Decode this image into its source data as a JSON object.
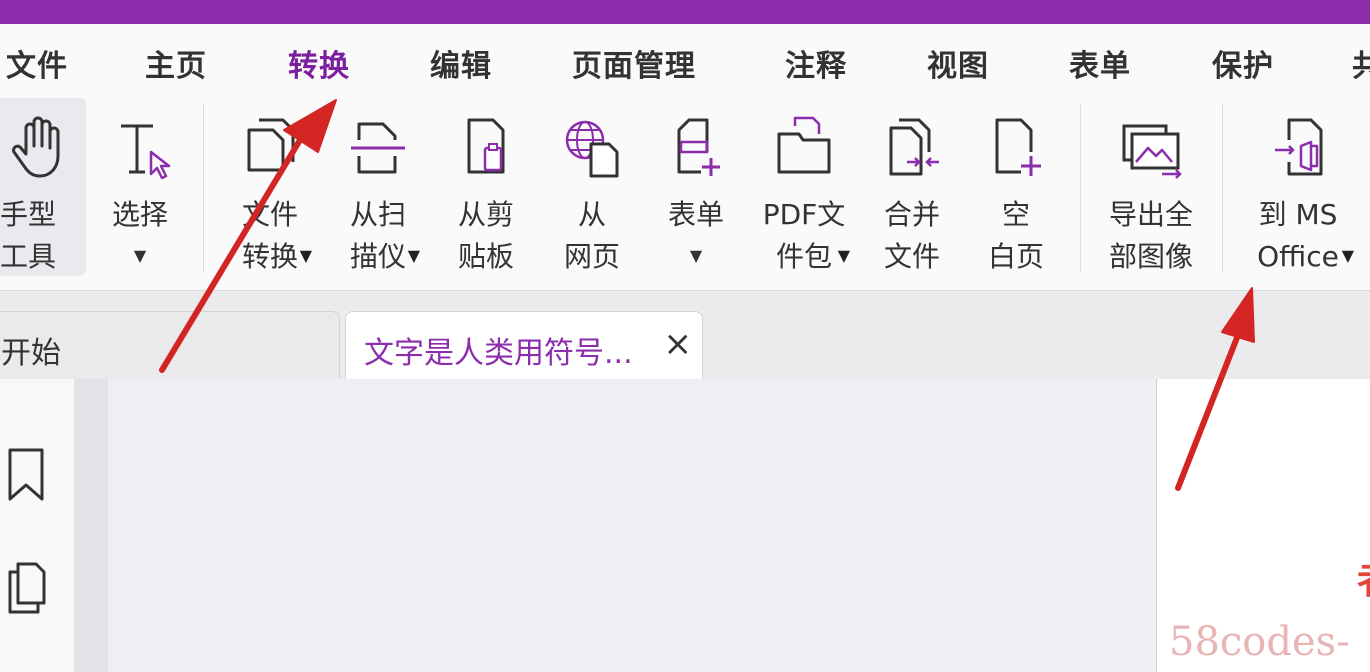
{
  "menu": {
    "items": [
      "文件",
      "主页",
      "转换",
      "编辑",
      "页面管理",
      "注释",
      "视图",
      "表单",
      "保护",
      "共"
    ],
    "active_index": 2
  },
  "ribbon": {
    "hand_tool": "手型\n工具",
    "select": "选择",
    "file_convert": "文件\n转换",
    "from_scanner": "从扫\n描仪",
    "from_clipboard": "从剪\n贴板",
    "from_webpage": "从\n网页",
    "form": "表单",
    "pdf_portfolio": "PDF文\n件包",
    "merge_files": "合并\n文件",
    "blank_page": "空\n白页",
    "export_images": "导出全\n部图像",
    "to_ms_office": "到 MS\nOffice"
  },
  "tabs": {
    "start": "开始",
    "document": "文字是人类用符号...",
    "close_glyph": "×"
  },
  "document": {
    "visible_char": "者"
  },
  "watermark": "58codes-",
  "colors": {
    "accent": "#8b2dac",
    "arrow": "#d42525"
  },
  "icons": [
    "hand-icon",
    "text-cursor-icon",
    "file-convert-icon",
    "scanner-icon",
    "clipboard-icon",
    "globe-page-icon",
    "form-icon",
    "portfolio-icon",
    "merge-icon",
    "blank-page-icon",
    "image-export-icon",
    "office-icon",
    "bookmark-icon",
    "pages-icon",
    "close-icon"
  ]
}
